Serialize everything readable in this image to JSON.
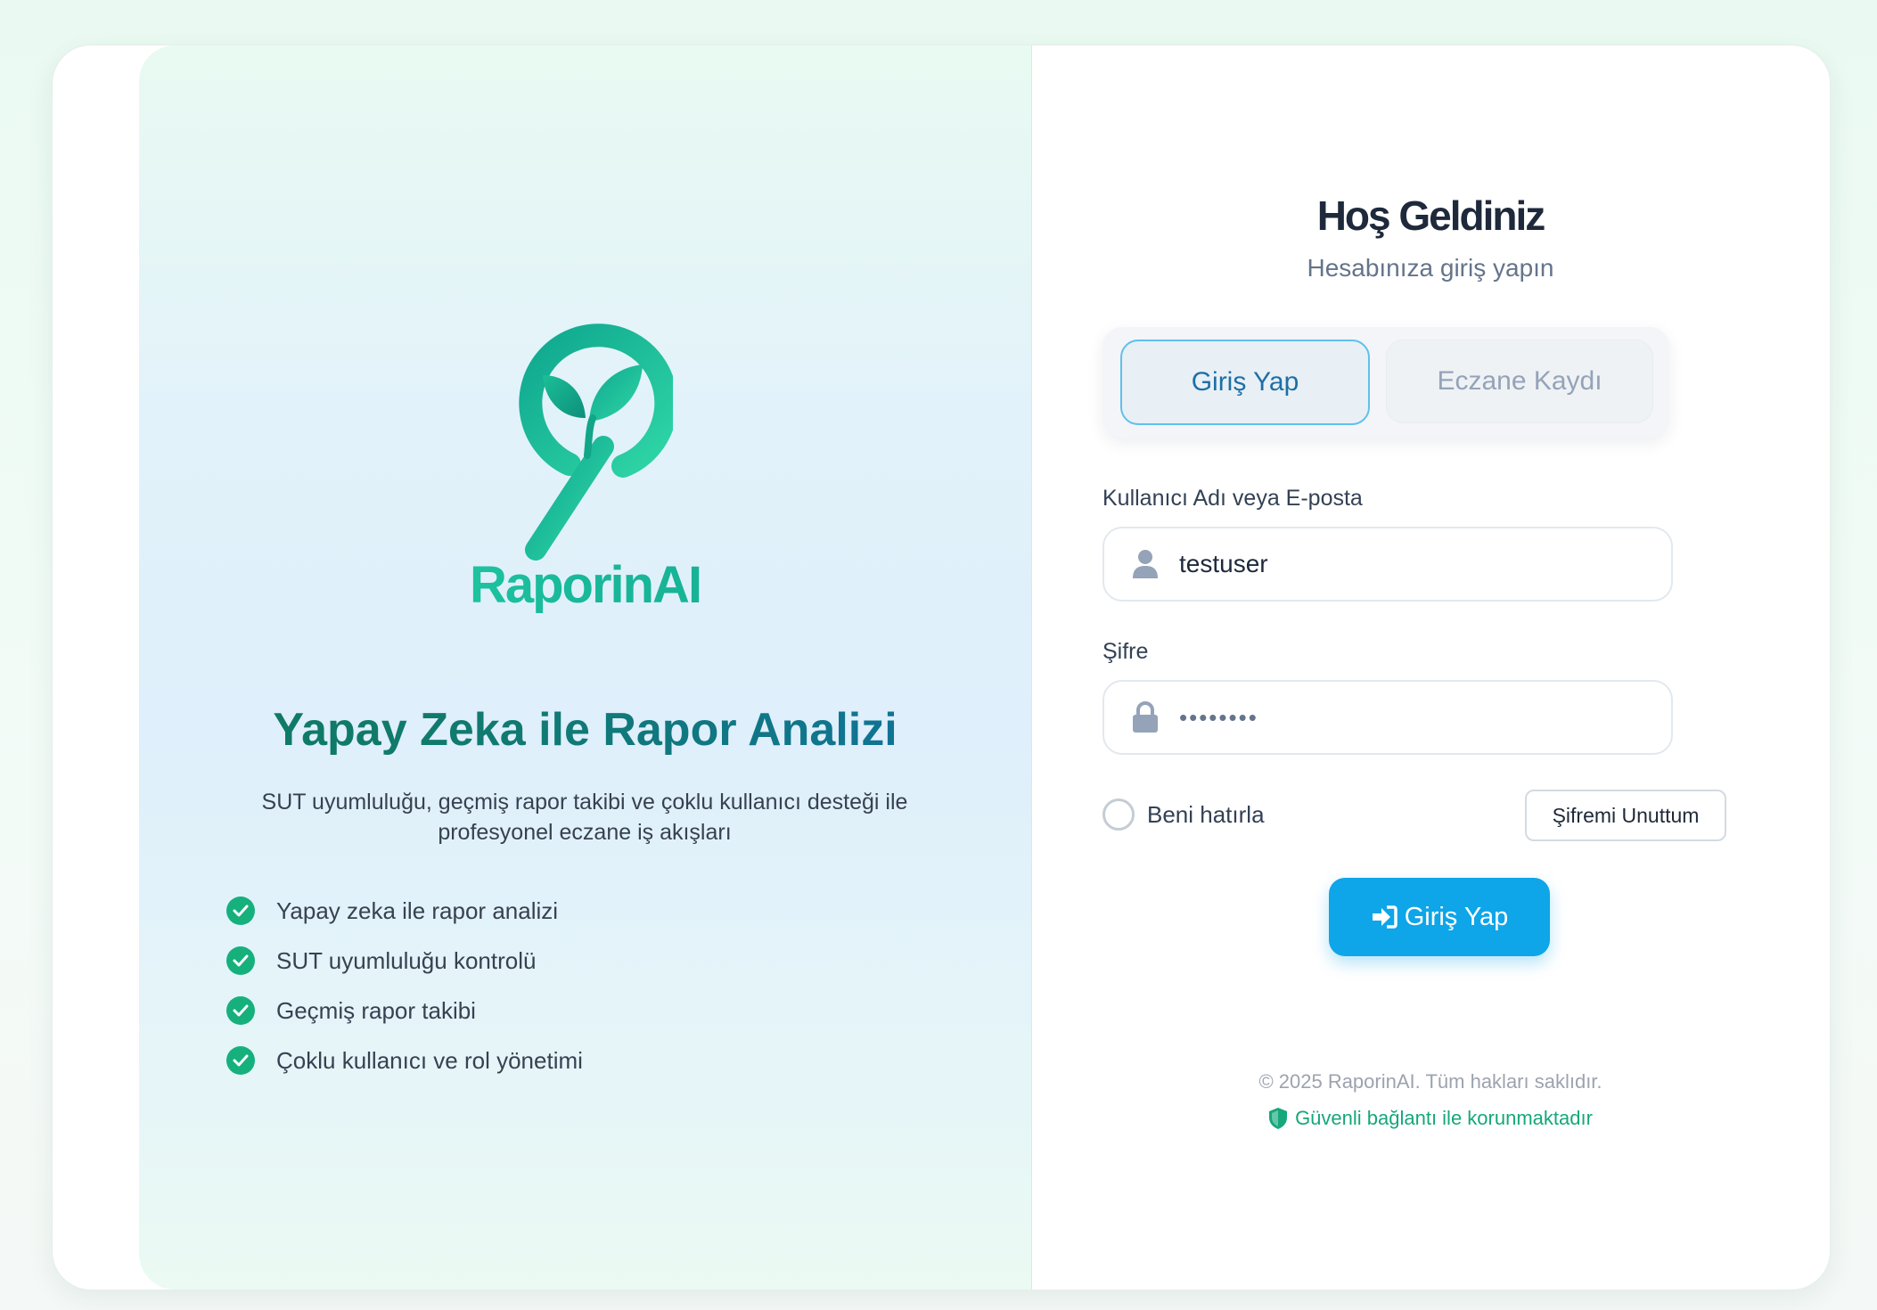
{
  "branding": {
    "logo_icon": "leaf-magnifier-icon",
    "app_name": "RaporinAI",
    "headline": "Yapay Zeka ile Rapor Analizi",
    "description": "SUT uyumluluğu, geçmiş rapor takibi ve çoklu kullanıcı desteği ile profesyonel eczane iş akışları",
    "features": [
      "Yapay zeka ile rapor analizi",
      "SUT uyumluluğu kontrolü",
      "Geçmiş rapor takibi",
      "Çoklu kullanıcı ve rol yönetimi"
    ]
  },
  "login": {
    "title": "Hoş Geldiniz",
    "subtitle": "Hesabınıza giriş yapın",
    "tabs": [
      {
        "label": "Giriş Yap",
        "active": true
      },
      {
        "label": "Eczane Kaydı",
        "active": false
      }
    ],
    "username_label": "Kullanıcı Adı veya E-posta",
    "username_value": "testuser",
    "username_icon": "user-icon",
    "password_label": "Şifre",
    "password_value": "••••••••",
    "password_icon": "lock-icon",
    "remember_label": "Beni hatırla",
    "remember_checked": false,
    "forgot_label": "Şifremi Unuttum",
    "submit_label": "Giriş Yap",
    "submit_icon": "sign-in-icon"
  },
  "footer": {
    "copyright": "© 2025 RaporinAI. Tüm hakları saklıdır.",
    "secure_text": "Güvenli bağlantı ile korunmaktadır",
    "secure_icon": "shield-icon"
  },
  "colors": {
    "accent": "#0ea5e9",
    "brand_green": "#16b07d",
    "title": "#1e293b"
  }
}
